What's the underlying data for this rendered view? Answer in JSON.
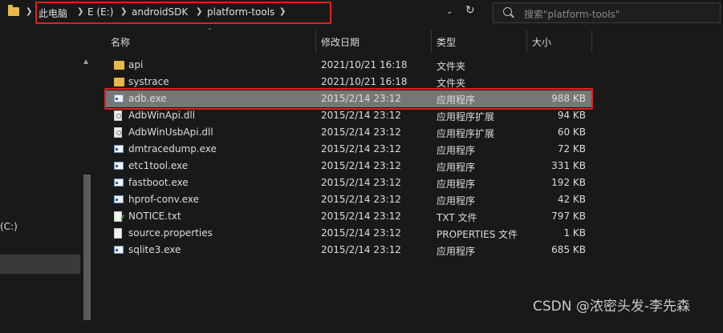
{
  "address_bar": {
    "crumbs": [
      "此电脑",
      "E (E:)",
      "androidSDK",
      "platform-tools"
    ]
  },
  "search": {
    "placeholder": "搜索\"platform-tools\""
  },
  "nav": {
    "drive_label": " (C:)"
  },
  "columns": {
    "name": "名称",
    "modified": "修改日期",
    "type": "类型",
    "size": "大小"
  },
  "files": [
    {
      "name": "api",
      "modified": "2021/10/21 16:18",
      "type": "文件夹",
      "size": "",
      "icon": "folder-icon"
    },
    {
      "name": "systrace",
      "modified": "2021/10/21 16:18",
      "type": "文件夹",
      "size": "",
      "icon": "folder-icon"
    },
    {
      "name": "adb.exe",
      "modified": "2015/2/14 23:12",
      "type": "应用程序",
      "size": "988 KB",
      "icon": "exe-icon",
      "selected": true
    },
    {
      "name": "AdbWinApi.dll",
      "modified": "2015/2/14 23:12",
      "type": "应用程序扩展",
      "size": "94 KB",
      "icon": "dll-icon"
    },
    {
      "name": "AdbWinUsbApi.dll",
      "modified": "2015/2/14 23:12",
      "type": "应用程序扩展",
      "size": "60 KB",
      "icon": "dll-icon"
    },
    {
      "name": "dmtracedump.exe",
      "modified": "2015/2/14 23:12",
      "type": "应用程序",
      "size": "72 KB",
      "icon": "exe-icon"
    },
    {
      "name": "etc1tool.exe",
      "modified": "2015/2/14 23:12",
      "type": "应用程序",
      "size": "331 KB",
      "icon": "exe-icon"
    },
    {
      "name": "fastboot.exe",
      "modified": "2015/2/14 23:12",
      "type": "应用程序",
      "size": "192 KB",
      "icon": "exe-icon"
    },
    {
      "name": "hprof-conv.exe",
      "modified": "2015/2/14 23:12",
      "type": "应用程序",
      "size": "42 KB",
      "icon": "exe-icon"
    },
    {
      "name": "NOTICE.txt",
      "modified": "2015/2/14 23:12",
      "type": "TXT 文件",
      "size": "797 KB",
      "icon": "txt-icon"
    },
    {
      "name": "source.properties",
      "modified": "2015/2/14 23:12",
      "type": "PROPERTIES 文件",
      "size": "1 KB",
      "icon": "file-icon"
    },
    {
      "name": "sqlite3.exe",
      "modified": "2015/2/14 23:12",
      "type": "应用程序",
      "size": "685 KB",
      "icon": "exe-icon"
    }
  ],
  "watermark": "CSDN @浓密头发-李先森",
  "colors": {
    "highlight_border": "#e02020",
    "selected_row": "#777777",
    "background": "#191919"
  }
}
